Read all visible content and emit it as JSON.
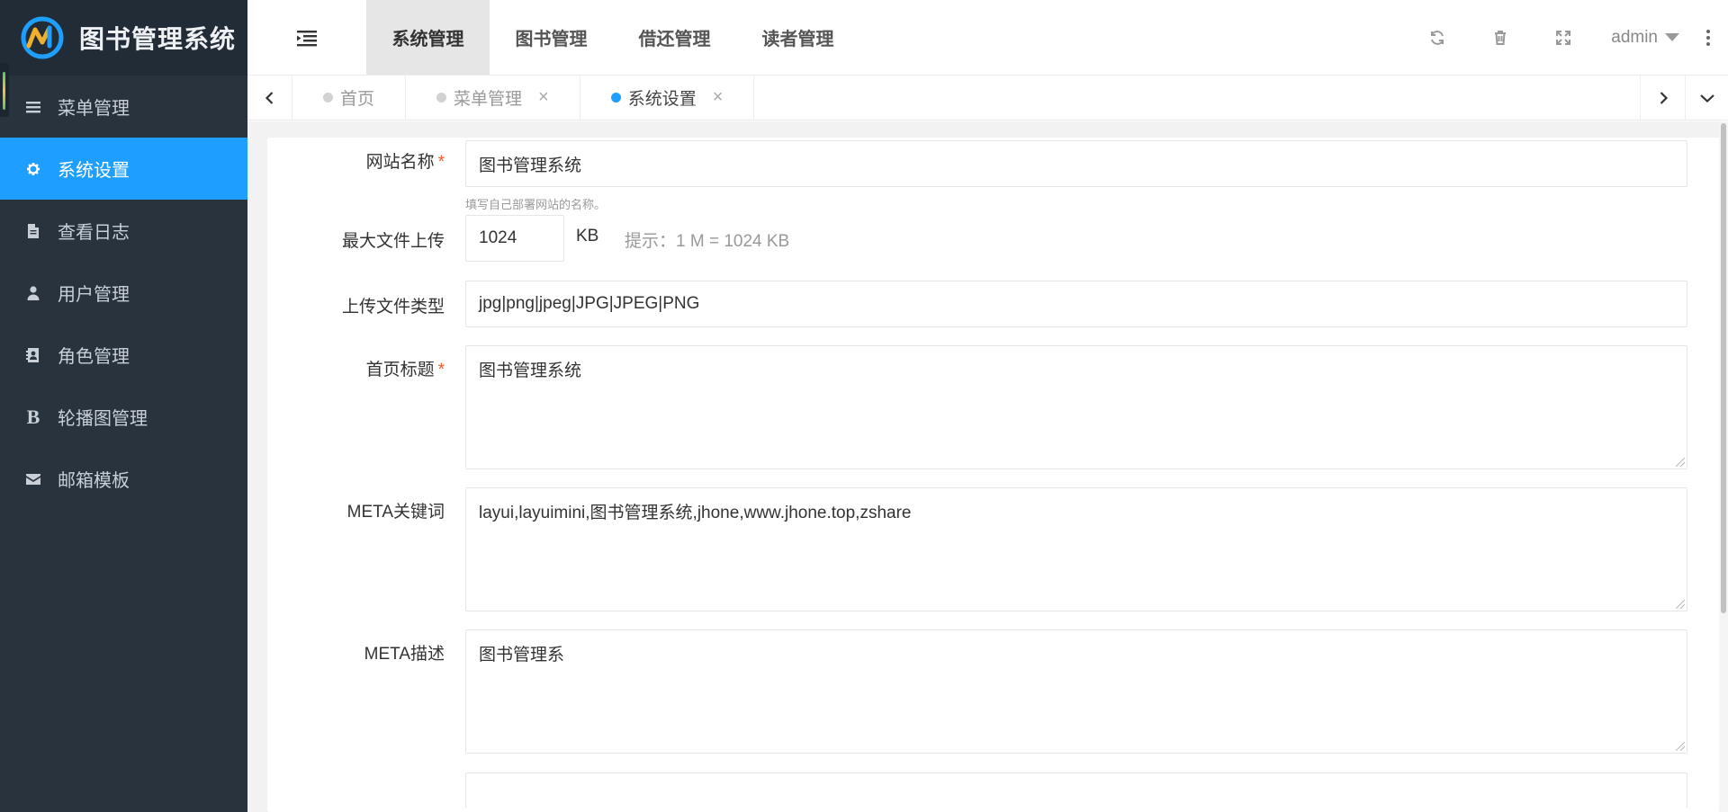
{
  "app": {
    "title": "图书管理系统"
  },
  "sidebar": {
    "items": [
      {
        "label": "菜单管理",
        "icon": "list-icon"
      },
      {
        "label": "系统设置",
        "icon": "gear-icon",
        "active": true
      },
      {
        "label": "查看日志",
        "icon": "file-icon"
      },
      {
        "label": "用户管理",
        "icon": "user-icon"
      },
      {
        "label": "角色管理",
        "icon": "contact-card-icon"
      },
      {
        "label": "轮播图管理",
        "icon": "bold-b-icon"
      },
      {
        "label": "邮箱模板",
        "icon": "envelope-icon"
      }
    ]
  },
  "header": {
    "nav": [
      {
        "label": "系统管理",
        "active": true
      },
      {
        "label": "图书管理"
      },
      {
        "label": "借还管理"
      },
      {
        "label": "读者管理"
      }
    ],
    "user": "admin"
  },
  "tabs": [
    {
      "label": "首页",
      "closable": false
    },
    {
      "label": "菜单管理",
      "closable": true
    },
    {
      "label": "系统设置",
      "closable": true,
      "active": true
    }
  ],
  "tab_close_glyph": "×",
  "form": {
    "site_name": {
      "label": "网站名称",
      "required_mark": "*",
      "value": "图书管理系统",
      "hint": "填写自己部署网站的名称。"
    },
    "max_upload": {
      "label": "最大文件上传",
      "value": "1024",
      "unit": "KB",
      "tip": "提示：1 M = 1024 KB"
    },
    "upload_types": {
      "label": "上传文件类型",
      "value": "jpg|png|jpeg|JPG|JPEG|PNG"
    },
    "home_title": {
      "label": "首页标题",
      "required_mark": "*",
      "value": "图书管理系统"
    },
    "meta_keywords": {
      "label": "META关键词",
      "value": "layui,layuimini,图书管理系统,jhone,www.jhone.top,zshare"
    },
    "meta_description": {
      "label": "META描述",
      "value": "图书管理系"
    }
  },
  "colors": {
    "sidebar_bg": "#28333e",
    "logo_bg": "#222c37",
    "accent": "#1e9fff",
    "required": "#ff5722"
  }
}
